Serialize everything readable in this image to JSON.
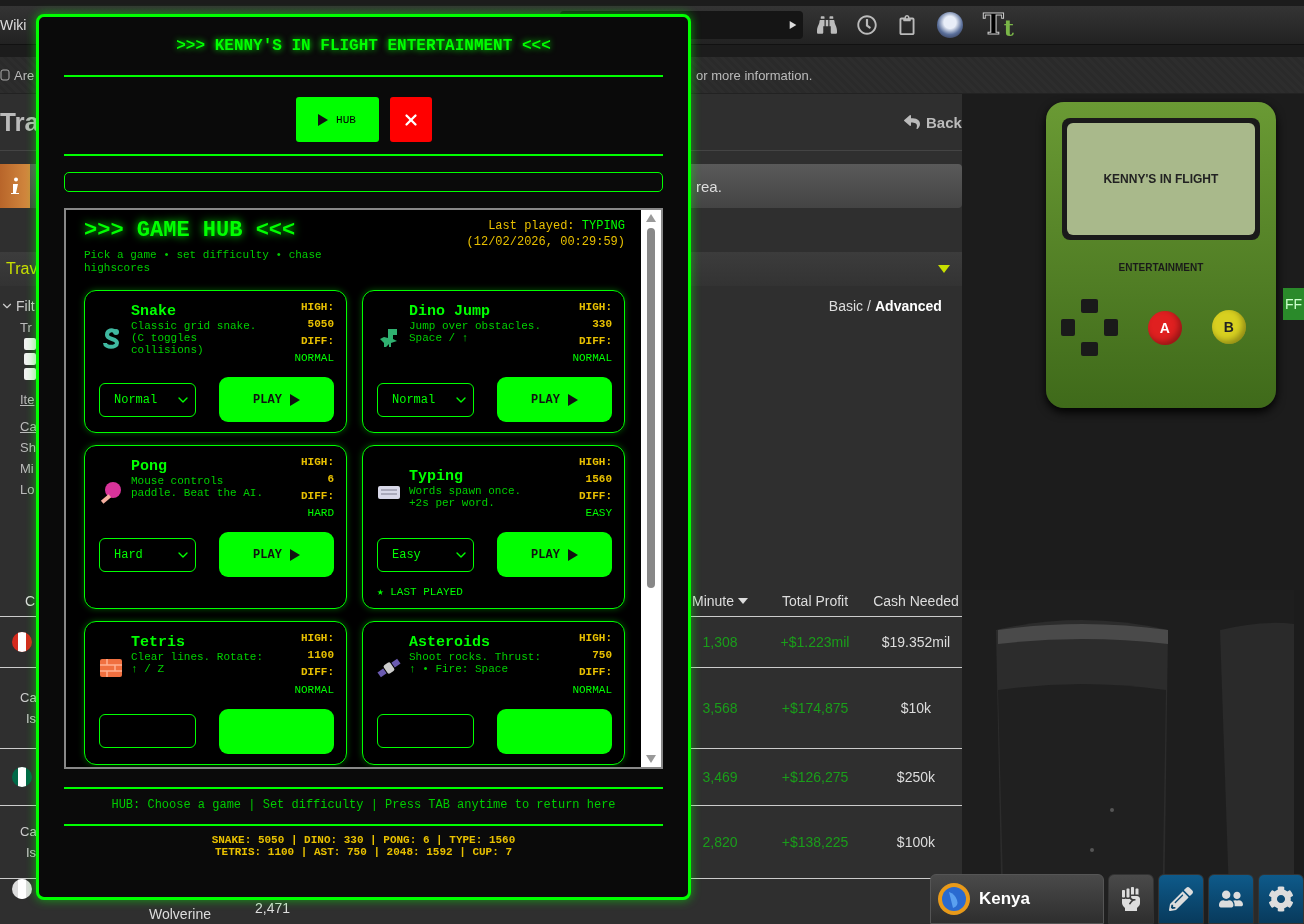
{
  "topbar": {
    "link": "Wiki",
    "logo": [
      "T",
      "t"
    ]
  },
  "notice": {
    "left": "Are",
    "right": "or more information."
  },
  "page": {
    "title": "Tra",
    "back": "Back",
    "info_text": "rea.",
    "section": "Trav",
    "filter_toggle": "Filt",
    "view_options": [
      {
        "label": "Basic",
        "selected": false
      },
      {
        "label": "Advanced",
        "selected": true
      }
    ],
    "view_separator": "/",
    "side_items": [
      {
        "kind": "text",
        "label": "Tr"
      },
      {
        "kind": "checkbox",
        "checked": false
      },
      {
        "kind": "checkbox",
        "checked": false
      },
      {
        "kind": "checkbox",
        "checked": false
      },
      {
        "kind": "link",
        "label": "Ite"
      },
      {
        "kind": "link",
        "label": "Ca"
      },
      {
        "kind": "text",
        "label": "Sh"
      },
      {
        "kind": "text",
        "label": "Mi"
      },
      {
        "kind": "text",
        "label": "Lo"
      }
    ]
  },
  "table": {
    "columns": [
      {
        "label": "C",
        "sorted": false
      },
      {
        "label": "Minute",
        "sorted": true
      },
      {
        "label": "Total Profit",
        "sorted": false
      },
      {
        "label": "Cash Needed",
        "sorted": false
      }
    ],
    "rows": [
      {
        "kind": "flag",
        "color": "#d52b1e",
        "minute": "1,308",
        "profit": "+$1.223mil",
        "cash": "$19.352mil"
      },
      {
        "kind": "named",
        "name_lines": [
          "Ca",
          "Is"
        ],
        "minute": "3,568",
        "profit": "+$174,875",
        "cash": "$10k"
      },
      {
        "kind": "flag",
        "color": "#006847",
        "minute": "3,469",
        "profit": "+$126,275",
        "cash": "$250k"
      },
      {
        "kind": "named",
        "name_lines": [
          "Ca",
          "Is"
        ],
        "minute": "2,820",
        "profit": "+$138,225",
        "cash": "$100k"
      },
      {
        "kind": "partial",
        "color": "#dddddd",
        "name": "Wolverine",
        "column_2": "2,471"
      }
    ]
  },
  "gameboy": {
    "screen_text": "KENNY'S IN FLIGHT",
    "label": "ENTERTAINMENT",
    "buttons": [
      {
        "label": "A",
        "color": "#e02020"
      },
      {
        "label": "B",
        "color": "#d8d020"
      }
    ]
  },
  "side_badge": "FF",
  "dock": {
    "player": "Kenya"
  },
  "overlay": {
    "title": ">>> KENNY'S IN FLIGHT ENTERTAINMENT <<<",
    "hub_button": "HUB",
    "hub": {
      "title": ">>> GAME HUB <<<",
      "subtitle": "Pick a game • set difficulty • chase highscores",
      "last_played_label": "Last played:",
      "last_played_game": "TYPING",
      "last_played_time": "(12/02/2026, 00:29:59)",
      "last_played_badge": "★ LAST PLAYED",
      "games": [
        {
          "kind": "snake",
          "name": "Snake",
          "description": "Classic grid snake. (C toggles collisions)",
          "high_label": "HIGH:",
          "high": "5050",
          "diff_label": "DIFF:",
          "diff": "NORMAL",
          "difficulty": "Normal",
          "play": "PLAY",
          "last_played": false
        },
        {
          "kind": "dino",
          "name": "Dino Jump",
          "description": "Jump over obstacles. Space / ↑",
          "high_label": "HIGH:",
          "high": "330",
          "diff_label": "DIFF:",
          "diff": "NORMAL",
          "difficulty": "Normal",
          "play": "PLAY",
          "last_played": false
        },
        {
          "kind": "pong",
          "name": "Pong",
          "description": "Mouse controls paddle. Beat the AI.",
          "high_label": "HIGH:",
          "high": "6",
          "diff_label": "DIFF:",
          "diff": "HARD",
          "difficulty": "Hard",
          "play": "PLAY",
          "last_played": false
        },
        {
          "kind": "typing",
          "name": "Typing",
          "description": "Words spawn once. +2s per word.",
          "high_label": "HIGH:",
          "high": "1560",
          "diff_label": "DIFF:",
          "diff": "EASY",
          "difficulty": "Easy",
          "play": "PLAY",
          "last_played": true
        },
        {
          "kind": "tetris",
          "name": "Tetris",
          "description": "Clear lines. Rotate: ↑ / Z",
          "high_label": "HIGH:",
          "high": "1100",
          "diff_label": "DIFF:",
          "diff": "NORMAL",
          "last_played": false
        },
        {
          "kind": "asteroids",
          "name": "Asteroids",
          "description": "Shoot rocks. Thrust: ↑ • Fire: Space",
          "high_label": "HIGH:",
          "high": "750",
          "diff_label": "DIFF:",
          "diff": "NORMAL",
          "last_played": false
        }
      ]
    },
    "help": "HUB: Choose a game | Set difficulty | Press TAB anytime to return here",
    "scores": [
      "SNAKE: 5050 | DINO: 330 | PONG: 6 | TYPE: 1560",
      "TETRIS: 1100 | AST: 750 | 2048: 1592 | CUP: 7"
    ]
  }
}
